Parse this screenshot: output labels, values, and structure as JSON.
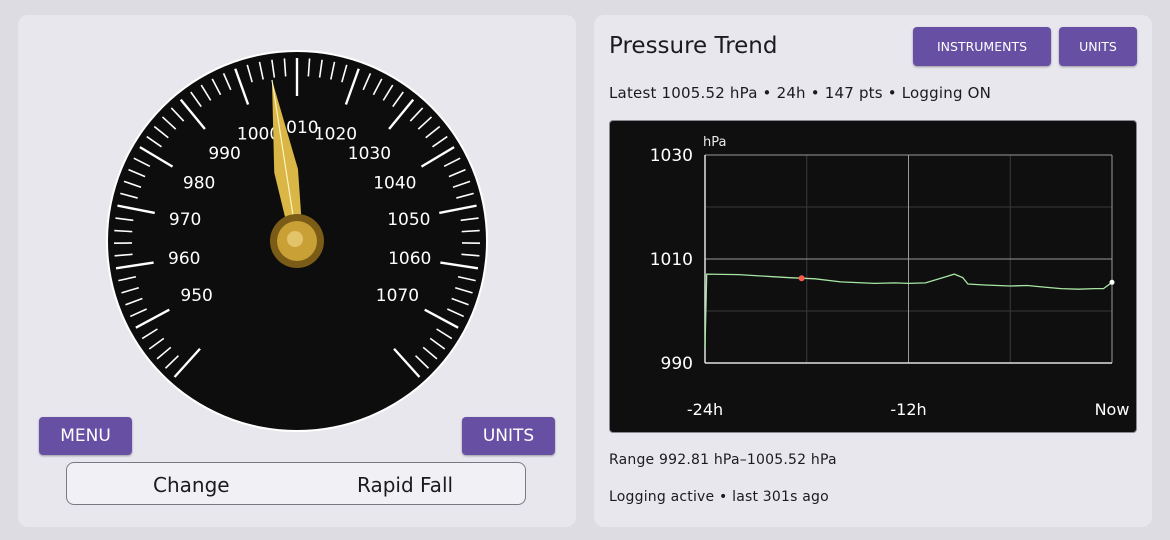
{
  "gauge": {
    "min": 940,
    "max": 1080,
    "major_labels": [
      "950",
      "960",
      "970",
      "980",
      "990",
      "1000",
      "1010",
      "1020",
      "1030",
      "1040",
      "1050",
      "1060",
      "1070"
    ],
    "needle_value": 1005.52,
    "colors": {
      "face": "#0d0d0d",
      "ticks": "#ffffff",
      "needle": "#d9b646",
      "hub": "#c9a036"
    }
  },
  "left_buttons": {
    "menu_label": "MENU",
    "units_label": "UNITS"
  },
  "change": {
    "label": "Change",
    "value": "Rapid Fall"
  },
  "trend": {
    "title": "Pressure Trend",
    "instruments_label": "INSTRUMENTS",
    "units_label": "UNITS",
    "latest_line": "Latest 1005.52  hPa • 24h • 147 pts • Logging ON",
    "range_line": "Range 992.81 hPa–1005.52 hPa",
    "logging_line": "Logging active • last 301s ago"
  },
  "chart_data": {
    "type": "line",
    "ylabel": "hPa",
    "ylim": [
      990,
      1030
    ],
    "yticks": [
      "1030",
      "1010",
      "990"
    ],
    "xticks": [
      "-24h",
      "-12h",
      "Now"
    ],
    "xlim": [
      -24,
      0
    ],
    "grid": true,
    "line_color": "#a8e6a3",
    "marker_color": "#ff5a4a",
    "series": [
      {
        "x": [
          -24,
          -23.9,
          -22,
          -20,
          -19,
          -17.5,
          -16,
          -14,
          -12.8,
          -12,
          -11,
          -9.8,
          -9.3,
          -8.8,
          -8.5,
          -7.5,
          -6,
          -5,
          -4,
          -3,
          -2,
          -1,
          -0.5,
          0
        ],
        "values": [
          992.8,
          1007.1,
          1007.0,
          1006.6,
          1006.4,
          1006.2,
          1005.6,
          1005.3,
          1005.4,
          1005.3,
          1005.4,
          1006.6,
          1007.1,
          1006.4,
          1005.2,
          1005.0,
          1004.8,
          1004.9,
          1004.6,
          1004.3,
          1004.2,
          1004.3,
          1004.3,
          1005.52
        ]
      }
    ],
    "marker": {
      "x": -18.3,
      "y": 1006.3
    }
  }
}
